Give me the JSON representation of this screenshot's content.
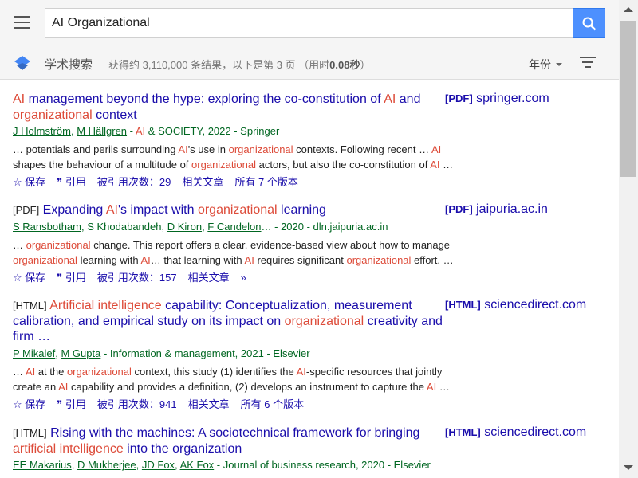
{
  "search": {
    "query": "AI Organizational"
  },
  "subbar": {
    "brand": "学术搜索",
    "stats_prefix": "获得约 3,110,000 条结果，以下是第 3 页 （用时",
    "stats_time": "0.08秒",
    "stats_suffix": "）",
    "year_filter": "年份"
  },
  "actions_labels": {
    "save": "☆ 保存",
    "cite": "❞ 引用",
    "related": "相关文章",
    "more": "»"
  },
  "results": [
    {
      "title_parts": [
        {
          "t": "AI",
          "hl": true
        },
        {
          "t": " management beyond the hype: exploring the co-constitution of "
        },
        {
          "t": "AI",
          "hl": true
        },
        {
          "t": " and "
        },
        {
          "t": "organizational",
          "hl": true
        },
        {
          "t": " context"
        }
      ],
      "authors": [
        {
          "t": "J Holmström",
          "u": true
        },
        {
          "t": ", "
        },
        {
          "t": "M Hällgren",
          "u": true
        },
        {
          "t": " - "
        },
        {
          "t": "AI",
          "hl": true
        },
        {
          "t": " & SOCIETY, 2022 - Springer"
        }
      ],
      "snippet": [
        {
          "t": "… potentials and perils surrounding "
        },
        {
          "t": "AI",
          "hl": true
        },
        {
          "t": "'s use in "
        },
        {
          "t": "organizational",
          "hl": true
        },
        {
          "t": " contexts. Following recent … "
        },
        {
          "t": "AI",
          "hl": true
        },
        {
          "t": " shapes the behaviour of a multitude of "
        },
        {
          "t": "organizational",
          "hl": true
        },
        {
          "t": " actors, but also the co-constitution of "
        },
        {
          "t": "AI",
          "hl": true
        },
        {
          "t": " …"
        }
      ],
      "cited": "被引用次数：29",
      "versions": "所有 7 个版本",
      "side_tag": "[PDF]",
      "side_domain": "springer.com"
    },
    {
      "title_tag": "[PDF]",
      "title_parts": [
        {
          "t": " Expanding "
        },
        {
          "t": "AI",
          "hl": true
        },
        {
          "t": "'s impact with "
        },
        {
          "t": "organizational",
          "hl": true
        },
        {
          "t": " learning"
        }
      ],
      "authors": [
        {
          "t": "S Ransbotham",
          "u": true
        },
        {
          "t": ", S Khodabandeh, "
        },
        {
          "t": "D Kiron",
          "u": true
        },
        {
          "t": ", "
        },
        {
          "t": "F Candelon",
          "u": true
        },
        {
          "t": "… - 2020 - dln.jaipuria.ac.in"
        }
      ],
      "snippet": [
        {
          "t": "… "
        },
        {
          "t": "organizational",
          "hl": true
        },
        {
          "t": " change. This report offers a clear, evidence-based view about how to manage "
        },
        {
          "t": "organizational",
          "hl": true
        },
        {
          "t": " learning with "
        },
        {
          "t": "AI",
          "hl": true
        },
        {
          "t": "… that learning with "
        },
        {
          "t": "AI",
          "hl": true
        },
        {
          "t": " requires significant "
        },
        {
          "t": "organizational",
          "hl": true
        },
        {
          "t": " effort. …"
        }
      ],
      "cited": "被引用次数：157",
      "versions": "",
      "side_tag": "[PDF]",
      "side_domain": "jaipuria.ac.in"
    },
    {
      "title_tag": "[HTML]",
      "title_parts": [
        {
          "t": " "
        },
        {
          "t": "Artificial intelligence",
          "hl": true
        },
        {
          "t": " capability: Conceptualization, measurement calibration, and empirical study on its impact on "
        },
        {
          "t": "organizational",
          "hl": true
        },
        {
          "t": " creativity and firm …"
        }
      ],
      "authors": [
        {
          "t": "P Mikalef",
          "u": true
        },
        {
          "t": ", "
        },
        {
          "t": "M Gupta",
          "u": true
        },
        {
          "t": " - Information & management, 2021 - Elsevier"
        }
      ],
      "snippet": [
        {
          "t": "… "
        },
        {
          "t": "AI",
          "hl": true
        },
        {
          "t": " at the "
        },
        {
          "t": "organizational",
          "hl": true
        },
        {
          "t": " context, this study (1) identifies the "
        },
        {
          "t": "AI",
          "hl": true
        },
        {
          "t": "-specific resources that jointly create an "
        },
        {
          "t": "AI",
          "hl": true
        },
        {
          "t": " capability and provides a definition, (2) develops an instrument to capture the "
        },
        {
          "t": "AI",
          "hl": true
        },
        {
          "t": " …"
        }
      ],
      "cited": "被引用次数：941",
      "versions": "所有 6 个版本",
      "side_tag": "[HTML]",
      "side_domain": "sciencedirect.com"
    },
    {
      "title_tag": "[HTML]",
      "title_parts": [
        {
          "t": " Rising with the machines: A sociotechnical framework for bringing "
        },
        {
          "t": "artificial intelligence",
          "hl": true
        },
        {
          "t": " into the organization"
        }
      ],
      "authors": [
        {
          "t": "EE Makarius",
          "u": true
        },
        {
          "t": ", "
        },
        {
          "t": "D Mukherjee",
          "u": true
        },
        {
          "t": ", "
        },
        {
          "t": "JD Fox",
          "u": true
        },
        {
          "t": ", "
        },
        {
          "t": "AK Fox",
          "u": true
        },
        {
          "t": " - Journal of business research, 2020 - Elsevier"
        }
      ],
      "snippet": [],
      "cited": "",
      "versions": "",
      "side_tag": "[HTML]",
      "side_domain": "sciencedirect.com"
    }
  ]
}
